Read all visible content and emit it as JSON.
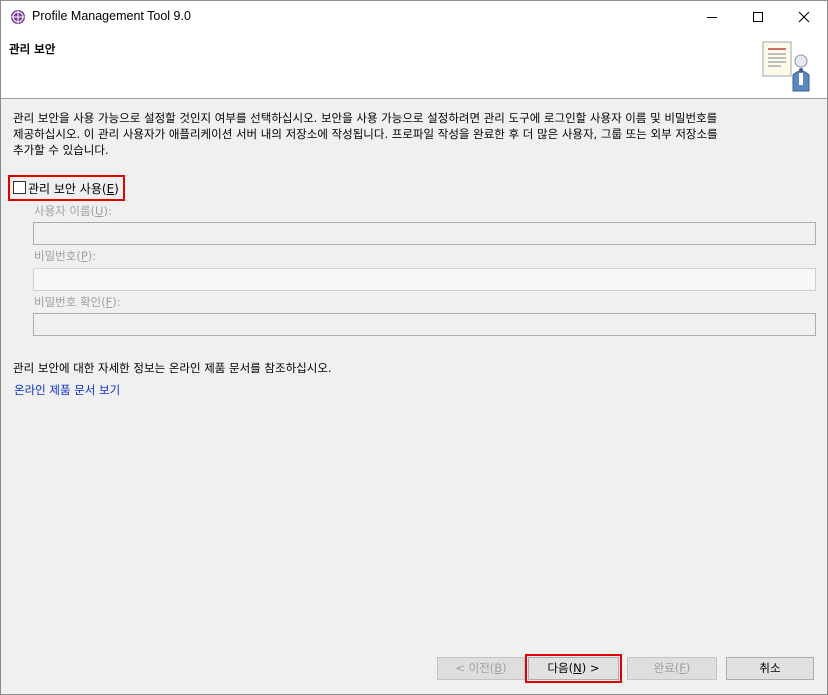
{
  "window": {
    "title": "Profile Management Tool 9.0"
  },
  "banner": {
    "title": "관리 보안"
  },
  "description": "관리 보안을 사용 가능으로 설정할 것인지 여부를 선택하십시오. 보안을 사용 가능으로 설정하려면 관리 도구에 로그인할 사용자 이름 및 비밀번호를\n제공하십시오. 이 관리 사용자가 애플리케이션 서버 내의 저장소에 작성됩니다. 프로파일 작성을 완료한 후 더 많은 사용자, 그룹 또는 외부 저장소를\n추가할 수 있습니다.",
  "security": {
    "checkbox_label": "관리 보안 사용(",
    "checkbox_mnemonic": "E",
    "checkbox_suffix": ")",
    "checked": false
  },
  "fields": {
    "username_label": "사용자 이름(",
    "username_mnemonic": "U",
    "password_label": "비밀번호(",
    "password_mnemonic": "P",
    "confirm_label": "비밀번호 확인(",
    "confirm_mnemonic": "F",
    "suffix": "):",
    "username_value": "",
    "password_value": "",
    "confirm_value": ""
  },
  "info": {
    "text": "관리 보안에 대한 자세한 정보는 온라인 제품 문서를 참조하십시오.",
    "link": "온라인 제품 문서 보기"
  },
  "buttons": {
    "back_label": "< 이전(",
    "back_mnemonic": "B",
    "next_label": "다음(",
    "next_mnemonic": "N",
    "next_suffix": ") >",
    "finish_label": "완료(",
    "finish_mnemonic": "F",
    "close_paren": ")",
    "cancel": "취소"
  },
  "colors": {
    "highlight": "#e00000",
    "link": "#0b31c8",
    "disabled_text": "#a0a0a0"
  }
}
